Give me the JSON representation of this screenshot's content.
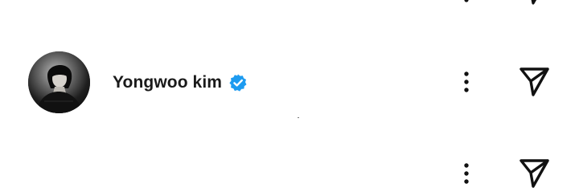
{
  "feed": {
    "rows": [
      {
        "id": "top-partial",
        "icons": {
          "more": "more-vertical-icon",
          "share": "send-icon"
        }
      },
      {
        "id": "main",
        "user_name": "Yongwoo kim",
        "verified": true,
        "icons": {
          "avatar": "profile-photo",
          "verified": "verified-badge-icon",
          "more": "more-vertical-icon",
          "share": "send-icon"
        }
      },
      {
        "id": "bottom",
        "icons": {
          "more": "more-vertical-icon",
          "share": "send-icon"
        }
      }
    ]
  },
  "colors": {
    "background": "#ffffff",
    "text": "#1a1a1a",
    "icon": "#111111",
    "verified_badge": "#1d9bf0"
  }
}
